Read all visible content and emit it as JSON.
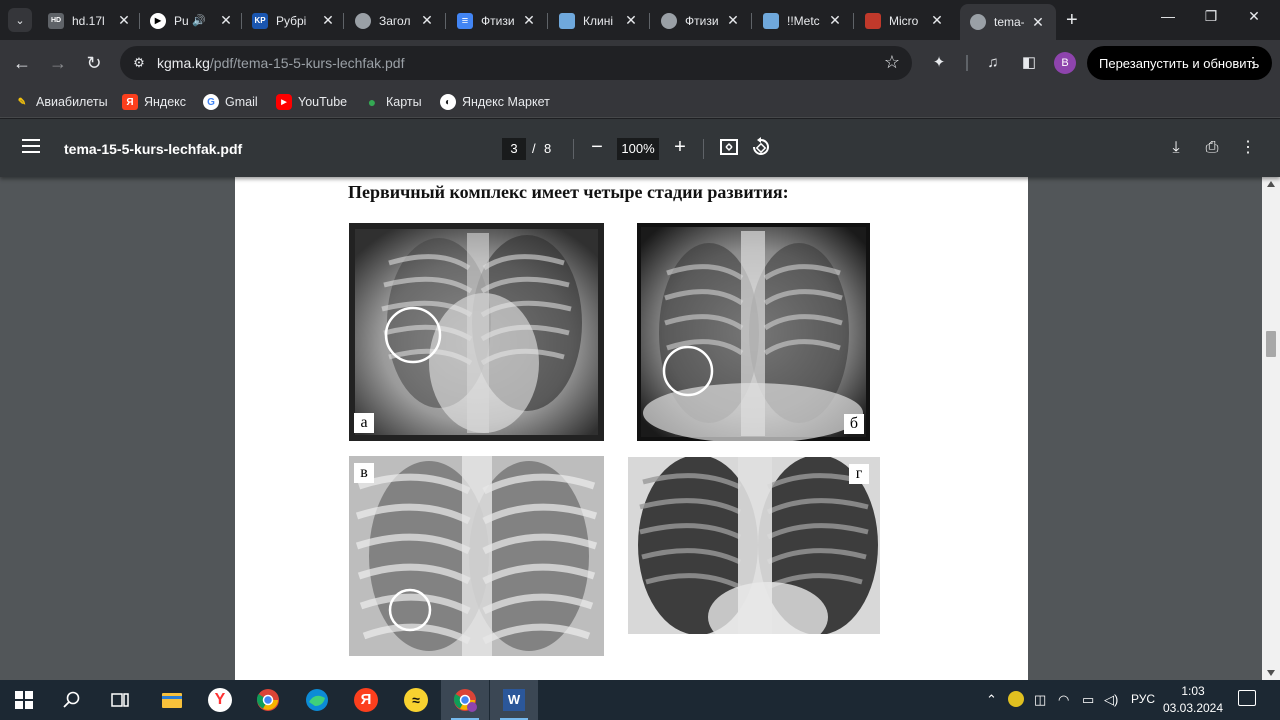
{
  "browser": {
    "tabs": [
      {
        "title": "hd.17l",
        "favicon_text": "HD",
        "favicon_color": "#5f6368"
      },
      {
        "title": "Pu",
        "favicon_text": "▶",
        "favicon_color": "#ffffff",
        "audio": true
      },
      {
        "title": "Рубрі",
        "favicon_text": "KP",
        "favicon_color": "#1a56b0"
      },
      {
        "title": "Загол",
        "favicon_text": "",
        "favicon_color": "#9aa0a6"
      },
      {
        "title": "Фтизи",
        "favicon_text": "≡",
        "favicon_color": "#4285f4"
      },
      {
        "title": "Клині",
        "favicon_text": "",
        "favicon_color": "#6fa8dc"
      },
      {
        "title": "Фтизи",
        "favicon_text": "",
        "favicon_color": "#9aa0a6"
      },
      {
        "title": "!!Metc",
        "favicon_text": "",
        "favicon_color": "#6fa8dc"
      },
      {
        "title": "Micro",
        "favicon_text": "",
        "favicon_color": "#c0392b"
      },
      {
        "title": "tema-",
        "favicon_text": "",
        "favicon_color": "#9aa0a6",
        "active": true
      }
    ],
    "new_tab_label": "+",
    "url": {
      "host": "kgma.kg",
      "path": "/pdf/tema-15-5-kurs-lechfak.pdf"
    },
    "profile_initial": "B",
    "relaunch_label": "Перезапустить и обновить",
    "bookmarks": [
      {
        "label": "Авиабилеты",
        "icon": "pencil-icon",
        "color": "#f4c20d"
      },
      {
        "label": "Яндекс",
        "icon": "yandex-icon",
        "color": "#fc3f1d"
      },
      {
        "label": "Gmail",
        "icon": "google-icon",
        "color": "#ffffff"
      },
      {
        "label": "YouTube",
        "icon": "youtube-icon",
        "color": "#ff0000"
      },
      {
        "label": "Карты",
        "icon": "maps-icon",
        "color": "#34a853"
      },
      {
        "label": "Яндекс Маркет",
        "icon": "market-icon",
        "color": "#ffffff"
      }
    ]
  },
  "pdf": {
    "filename": "tema-15-5-kurs-lechfak.pdf",
    "current_page": "3",
    "page_separator": "/",
    "total_pages": "8",
    "zoom": "100%",
    "heading": "Первичный комплекс имеет четыре стадии развития:",
    "figures": [
      {
        "label": "а",
        "has_circle": true
      },
      {
        "label": "б",
        "has_circle": true
      },
      {
        "label": "в",
        "has_circle": true
      },
      {
        "label": "г",
        "has_circle": false
      }
    ]
  },
  "taskbar": {
    "language": "РУС",
    "time": "1:03",
    "date": "03.03.2024"
  }
}
